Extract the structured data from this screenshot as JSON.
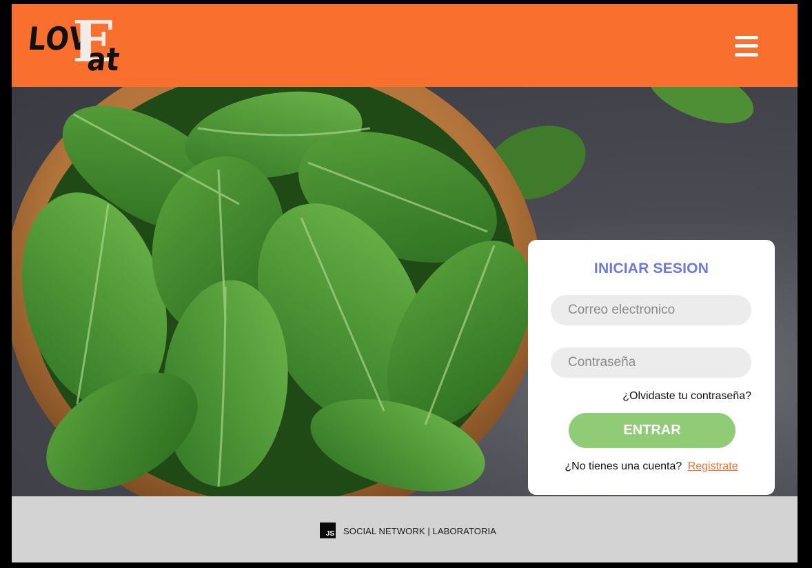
{
  "header": {
    "logo": {
      "part1": "LOV",
      "part2": "E",
      "part3": "at"
    },
    "menu_icon": "hamburger-menu-icon",
    "background_color": "#f86f2e"
  },
  "login": {
    "title": "INICIAR SESION",
    "email_placeholder": "Correo electronico",
    "password_placeholder": "Contraseña",
    "forgot_password": "¿Olvidaste tu contraseña?",
    "submit_label": "ENTRAR",
    "no_account_text": "¿No tienes una cuenta?",
    "register_link": "Registrate"
  },
  "footer": {
    "badge": "JS",
    "text": "SOCIAL NETWORK | LABORATORIA"
  },
  "colors": {
    "accent": "#f86f2e",
    "title": "#6b78e0",
    "button": "#90cc76",
    "footer_bg": "#d3d3d3"
  }
}
